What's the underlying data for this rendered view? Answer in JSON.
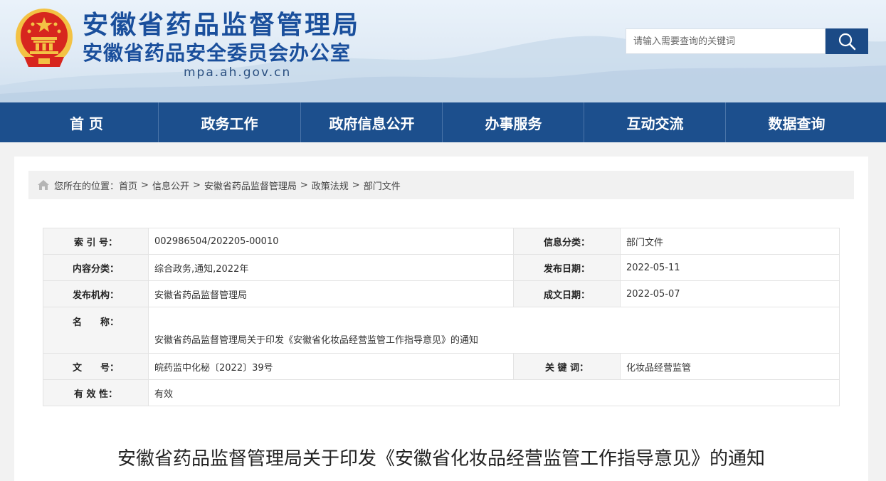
{
  "header": {
    "title": "安徽省药品监督管理局",
    "subtitle": "安徽省药品安全委员会办公室",
    "domain": "mpa.ah.gov.cn"
  },
  "search": {
    "placeholder": "请输入需要查询的关键词",
    "icon": "search-icon"
  },
  "nav": {
    "items": [
      "首 页",
      "政务工作",
      "政府信息公开",
      "办事服务",
      "互动交流",
      "数据查询"
    ]
  },
  "breadcrumb": {
    "prefix": "您所在的位置：",
    "items": [
      "首页",
      "信息公开",
      "安徽省药品监督管理局",
      "政策法规",
      "部门文件"
    ],
    "separator": ">"
  },
  "meta": {
    "index_label": "索 引 号：",
    "index_value": "002986504/202205-00010",
    "info_class_label": "信息分类：",
    "info_class_value": "部门文件",
    "content_class_label": "内容分类：",
    "content_class_value": "综合政务,通知,2022年",
    "publish_date_label": "发布日期：",
    "publish_date_value": "2022-05-11",
    "org_label": "发布机构：",
    "org_value": "安徽省药品监督管理局",
    "doc_date_label": "成文日期：",
    "doc_date_value": "2022-05-07",
    "name_label": "名　　称：",
    "name_value": "安徽省药品监督管理局关于印发《安徽省化妆品经营监管工作指导意见》的通知",
    "docno_label": "文　　号：",
    "docno_value": "皖药监中化秘〔2022〕39号",
    "keyword_label": "关 键 词：",
    "keyword_value": "化妆品经营监管",
    "validity_label": "有 效 性：",
    "validity_value": "有效"
  },
  "article": {
    "title": "安徽省药品监督管理局关于印发《安徽省化妆品经营监管工作指导意见》的通知"
  },
  "colors": {
    "nav_bg": "#1c4f8d",
    "title_blue": "#1a4f9c",
    "search_btn": "#1b4a86",
    "emblem_red": "#d7261e",
    "emblem_gold": "#f3c244"
  }
}
